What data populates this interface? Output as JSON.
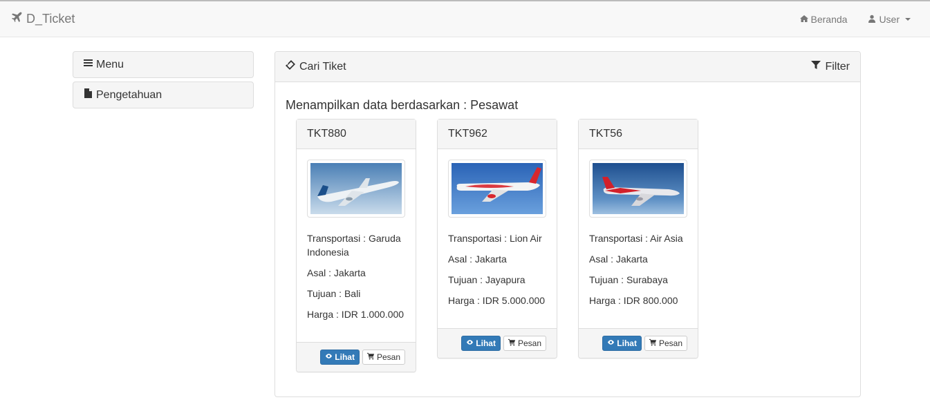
{
  "navbar": {
    "brand": "D_Ticket",
    "home_label": "Beranda",
    "user_label": "User"
  },
  "sidebar": {
    "items": [
      {
        "label": "Menu",
        "icon": "bars-icon"
      },
      {
        "label": "Pengetahuan",
        "icon": "file-icon"
      }
    ]
  },
  "panel": {
    "title": "Cari Tiket",
    "filter_label": "Filter",
    "result_label": "Menampilkan data berdasarkan : Pesawat"
  },
  "tickets": [
    {
      "code": "TKT880",
      "transport": "Transportasi : Garuda Indonesia",
      "origin": "Asal : Jakarta",
      "destination": "Tujuan : Bali",
      "price": "Harga : IDR 1.000.000",
      "view_label": "Lihat",
      "order_label": "Pesan"
    },
    {
      "code": "TKT962",
      "transport": "Transportasi : Lion Air",
      "origin": "Asal : Jakarta",
      "destination": "Tujuan : Jayapura",
      "price": "Harga : IDR 5.000.000",
      "view_label": "Lihat",
      "order_label": "Pesan"
    },
    {
      "code": "TKT56",
      "transport": "Transportasi : Air Asia",
      "origin": "Asal : Jakarta",
      "destination": "Tujuan : Surabaya",
      "price": "Harga : IDR 800.000",
      "view_label": "Lihat",
      "order_label": "Pesan"
    }
  ],
  "colors": {
    "primary": "#337ab7",
    "panel_bg": "#f5f5f5",
    "border": "#dddddd"
  }
}
